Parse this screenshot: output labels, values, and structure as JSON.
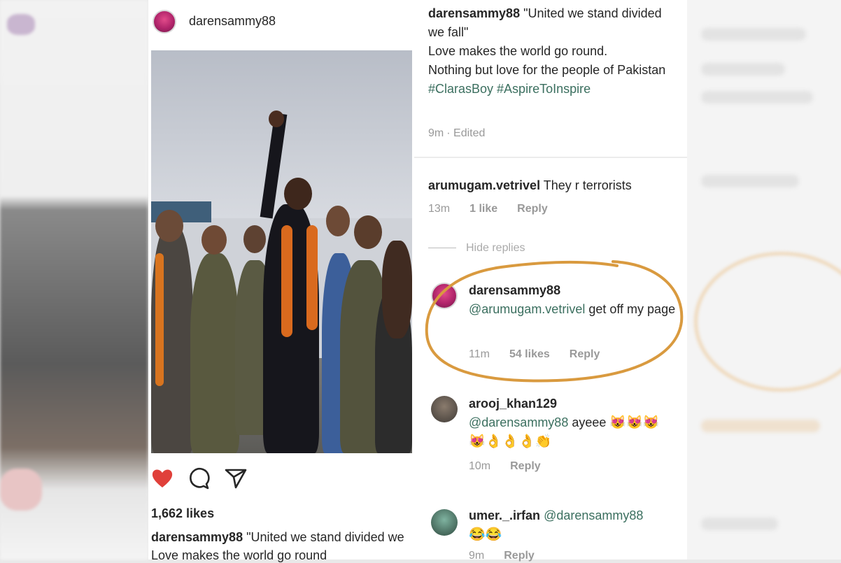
{
  "post": {
    "username": "darensammy88",
    "likes": "1,662 likes",
    "caption_user": "darensammy88",
    "caption_text": "\"United we stand divided we",
    "caption_line2": "Love makes the world go round"
  },
  "caption_panel": {
    "username": "darensammy88",
    "text1": "\"United we stand divided we fall\"",
    "text2": "Love makes the world go round.",
    "text3": "Nothing but love for the people of Pakistan",
    "hashtags": "#ClarasBoy #AspireToInspire",
    "time": "9m",
    "edited": "Edited"
  },
  "comments": [
    {
      "username": "arumugam.vetrivel",
      "text": "They r terrorists",
      "time": "13m",
      "likes": "1 like",
      "reply": "Reply"
    },
    {
      "hide_replies": "Hide replies",
      "username": "darensammy88",
      "mention": "@arumugam.vetrivel",
      "text": "get off my page",
      "time": "11m",
      "likes": "54 likes",
      "reply": "Reply"
    },
    {
      "username": "arooj_khan129",
      "mention": "@darensammy88",
      "text": "ayeee",
      "emojis1": "😻😻😻",
      "emojis2": "😻👌👌👌👏",
      "time": "10m",
      "reply": "Reply"
    },
    {
      "username": "umer._.irfan",
      "mention": "@darensammy88",
      "emojis": "😂😂",
      "time": "9m",
      "reply": "Reply"
    }
  ],
  "colors": {
    "heart": "#e0403a",
    "highlight_ring": "#d99a3f",
    "hashtag": "#3b6f5f"
  },
  "icons": [
    "heart-icon",
    "comment-icon",
    "share-icon"
  ]
}
